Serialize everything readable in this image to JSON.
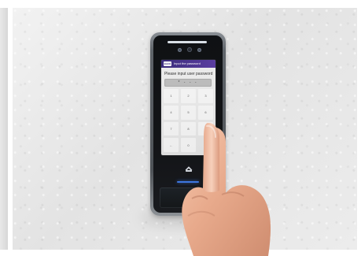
{
  "screen": {
    "back_label": "BACK",
    "header_title": "Input the password",
    "prompt": "Please input user password",
    "password_value": "* - - -",
    "keypad": [
      "1",
      "2",
      "3",
      "4",
      "5",
      "6",
      "7",
      "8",
      "9",
      "←",
      "0",
      ""
    ]
  },
  "icons": {
    "backspace": "left-arrow-icon",
    "reader": "card-reader-icon",
    "sensors": "sensor-icon"
  },
  "colors": {
    "screen_header": "#4a358f",
    "accent_line": "#3e77e0",
    "device_frame": "#5f646a"
  }
}
